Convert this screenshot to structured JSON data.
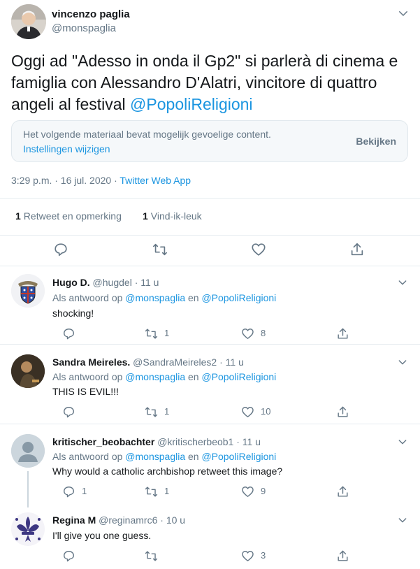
{
  "tweet": {
    "author_name": "vincenzo paglia",
    "author_handle": "@monspaglia",
    "text_line1": "Oggi ad \"Adesso in onda il Gp2\" si parlerà di cinema e",
    "text_line2": "famiglia con Alessandro D'Alatri, vincitore di quattro",
    "text_line3_plain": "angeli al festival ",
    "text_mention": "@PopoliReligioni",
    "sensitive_notice": "Het volgende materiaal bevat mogelijk gevoelige content.",
    "sensitive_settings": "Instellingen wijzigen",
    "sensitive_view": "Bekijken",
    "timestamp": "3:29 p.m. · 16 jul. 2020 · ",
    "source": "Twitter Web App",
    "retweets_count": "1",
    "retweets_label": "Retweet en opmerking",
    "likes_count": "1",
    "likes_label": "Vind-ik-leuk"
  },
  "replies": [
    {
      "name": "Hugo D.",
      "handle": "@hugdel",
      "time": "· 11 u",
      "reply_prefix": "Als antwoord op ",
      "reply_to_1": "@monspaglia",
      "reply_and": " en ",
      "reply_to_2": "@PopoliReligioni",
      "text": "shocking!",
      "replies": "",
      "retweets": "1",
      "likes": "8"
    },
    {
      "name": "Sandra Meireles.",
      "handle": "@SandraMeireles2",
      "time": "· 11 u",
      "reply_prefix": "Als antwoord op ",
      "reply_to_1": "@monspaglia",
      "reply_and": " en ",
      "reply_to_2": "@PopoliReligioni",
      "text": "THIS IS EVIL!!!",
      "replies": "",
      "retweets": "1",
      "likes": "10"
    },
    {
      "name": "kritischer_beobachter",
      "handle": "@kritischerbeob1",
      "time": "· 11 u",
      "reply_prefix": "Als antwoord op ",
      "reply_to_1": "@monspaglia",
      "reply_and": " en ",
      "reply_to_2": "@PopoliReligioni",
      "text": "Why would a catholic archbishop retweet this image?",
      "replies": "1",
      "retweets": "1",
      "likes": "9"
    },
    {
      "name": "Regina M",
      "handle": "@reginamrc6",
      "time": "· 10 u",
      "text": "I'll give you one guess.",
      "replies": "",
      "retweets": "",
      "likes": "3"
    }
  ],
  "colors": {
    "link_blue": "#1b95e0",
    "secondary_gray": "#657786",
    "border": "#e6ecf0"
  },
  "icons": [
    "reply-icon",
    "retweet-icon",
    "like-icon",
    "share-icon",
    "chevron-down-icon",
    "default-avatar-icon",
    "fleur-de-lis-icon",
    "coat-of-arms-icon"
  ]
}
